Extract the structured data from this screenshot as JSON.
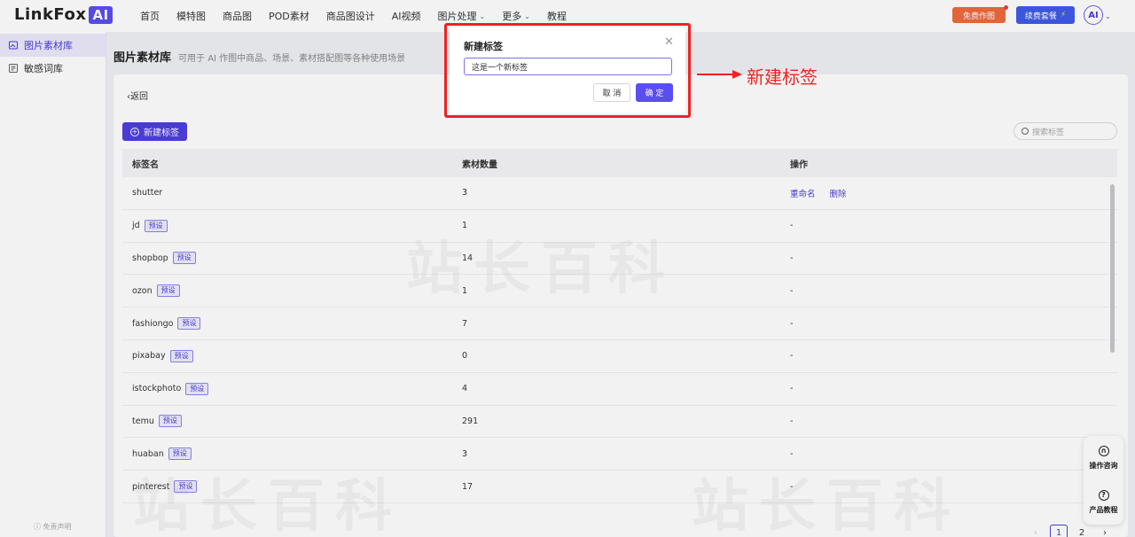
{
  "brand": {
    "logo_text": "LinkFox",
    "logo_ai": "AI"
  },
  "nav": {
    "items": [
      {
        "label": "首页"
      },
      {
        "label": "模特图"
      },
      {
        "label": "商品图"
      },
      {
        "label": "POD素材"
      },
      {
        "label": "商品图设计"
      },
      {
        "label": "AI视频"
      },
      {
        "label": "图片处理",
        "has_menu": true
      },
      {
        "label": "更多",
        "has_menu": true
      },
      {
        "label": "教程"
      }
    ],
    "free_btn": "免费作图",
    "renew_btn": "续费套餐",
    "avatar_text": "AI"
  },
  "sidebar": {
    "items": [
      {
        "label": "图片素材库",
        "active": true
      },
      {
        "label": "敏感词库",
        "active": false
      }
    ],
    "footer": "免责声明"
  },
  "page": {
    "title": "图片素材库",
    "subtitle": "可用于 AI 作图中商品、场景、素材搭配图等各种使用场景",
    "back_label": "返回",
    "new_tag_btn": "新建标签",
    "search_placeholder": "搜索标签"
  },
  "table": {
    "headers": [
      "标签名",
      "素材数量",
      "操作"
    ],
    "rows": [
      {
        "name": "shutter",
        "preset": false,
        "count": "3",
        "ops": [
          "重命名",
          "删除"
        ]
      },
      {
        "name": "jd",
        "preset": true,
        "count": "1",
        "ops": []
      },
      {
        "name": "shopbop",
        "preset": true,
        "count": "14",
        "ops": []
      },
      {
        "name": "ozon",
        "preset": true,
        "count": "1",
        "ops": []
      },
      {
        "name": "fashiongo",
        "preset": true,
        "count": "7",
        "ops": []
      },
      {
        "name": "pixabay",
        "preset": true,
        "count": "0",
        "ops": []
      },
      {
        "name": "istockphoto",
        "preset": true,
        "count": "4",
        "ops": []
      },
      {
        "name": "temu",
        "preset": true,
        "count": "291",
        "ops": []
      },
      {
        "name": "huaban",
        "preset": true,
        "count": "3",
        "ops": []
      },
      {
        "name": "pinterest",
        "preset": true,
        "count": "17",
        "ops": []
      }
    ],
    "preset_label": "预设",
    "empty_op": "-"
  },
  "pagination": {
    "pages": [
      "1",
      "2"
    ],
    "current": "1"
  },
  "float_help": {
    "consult": "操作咨询",
    "tutorial": "产品教程"
  },
  "watermark": "站长百科",
  "modal": {
    "title": "新建标签",
    "input_value": "这是一个新标签",
    "cancel": "取 消",
    "ok": "确 定"
  },
  "annotation": {
    "text": "新建标签",
    "color": "#ee2222"
  },
  "colors": {
    "accent": "#5b4ef0",
    "free_btn": "#f06a3c",
    "renew_btn": "#3f5be8"
  }
}
